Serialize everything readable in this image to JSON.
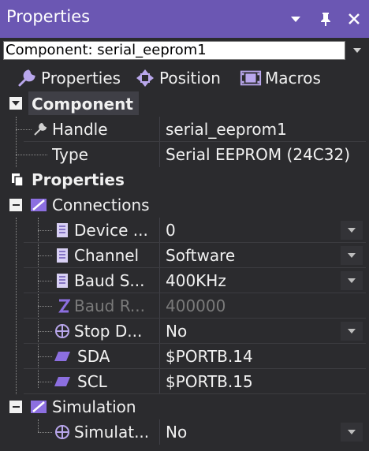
{
  "titlebar": {
    "title": "Properties"
  },
  "component_selector": {
    "value": "Component: serial_eeprom1"
  },
  "tabs": [
    {
      "label": "Properties",
      "icon": "wrench-icon"
    },
    {
      "label": "Position",
      "icon": "move-arrows-icon"
    },
    {
      "label": "Macros",
      "icon": "film-strip-icon"
    }
  ],
  "grid": {
    "component_category": "Component",
    "handle": {
      "label": "Handle",
      "value": "serial_eeprom1"
    },
    "type": {
      "label": "Type",
      "value": "Serial EEPROM (24C32)"
    },
    "properties_category": "Properties",
    "connections_group": "Connections",
    "device": {
      "label": "Device ...",
      "value": "0"
    },
    "channel": {
      "label": "Channel",
      "value": "Software"
    },
    "baud_speed": {
      "label": "Baud S...",
      "value": "400KHz"
    },
    "baud_rate": {
      "label": "Baud R...",
      "value": "400000"
    },
    "stop_delay": {
      "label": "Stop D...",
      "value": "No"
    },
    "sda": {
      "label": "SDA",
      "value": "$PORTB.14"
    },
    "scl": {
      "label": "SCL",
      "value": "$PORTB.15"
    },
    "simulation_group": "Simulation",
    "simulate": {
      "label": "Simulat...",
      "value": "No"
    }
  },
  "colors": {
    "titlebar": "#6b57b3",
    "background": "#2b2b2e",
    "text": "#f1f1f1",
    "disabled_text": "#7a7a7a",
    "accent_purple": "#8c6fe0"
  }
}
